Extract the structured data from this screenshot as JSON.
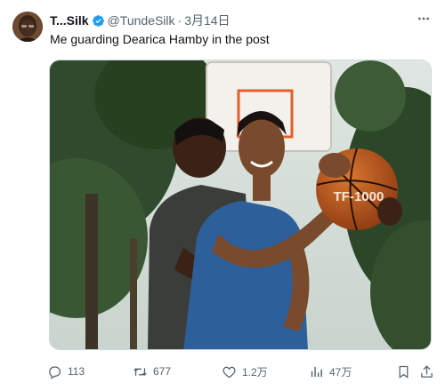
{
  "author": {
    "display_name": "T...Silk",
    "handle": "@TundeSilk",
    "separator": "·",
    "date": "3月14日",
    "verified": true
  },
  "tweet": {
    "text": "Me guarding Dearica Hamby in the post"
  },
  "media": {
    "ball_text": "TF-1000"
  },
  "actions": {
    "replies": "113",
    "retweets": "677",
    "likes": "1.2万",
    "views": "47万"
  },
  "colors": {
    "verified": "#1d9bf0",
    "secondary_text": "#536471",
    "primary_text": "#0f1419"
  }
}
